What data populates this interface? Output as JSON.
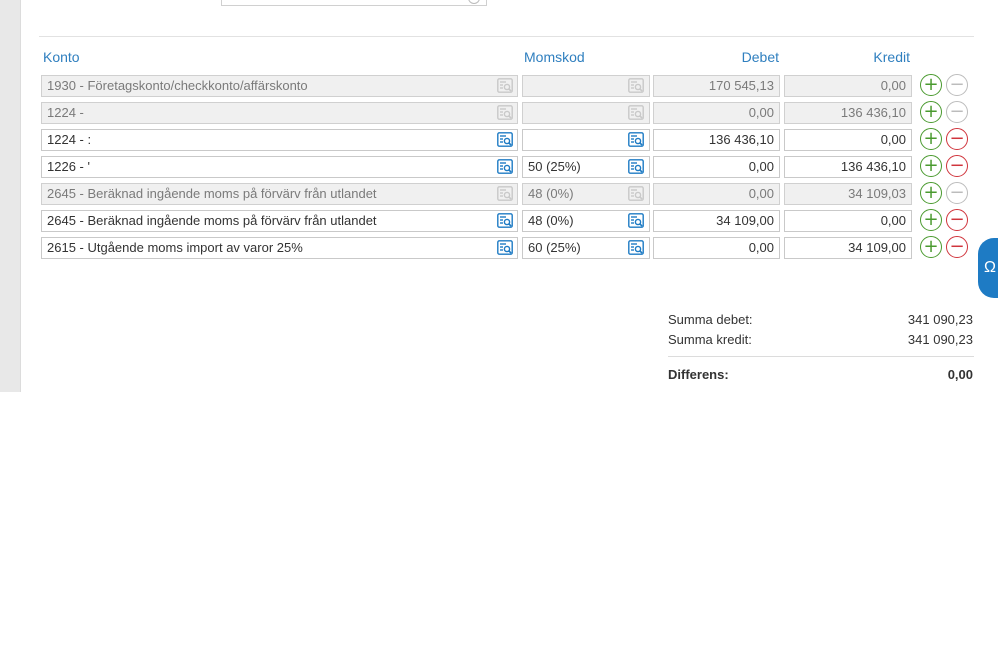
{
  "headers": {
    "konto": "Konto",
    "momskod": "Momskod",
    "debet": "Debet",
    "kredit": "Kredit"
  },
  "rows": [
    {
      "konto": "1930 - Företagskonto/checkkonto/affärskonto",
      "momskod": "",
      "debet": "170 545,13",
      "kredit": "0,00",
      "disabled": true
    },
    {
      "konto": "1224 -",
      "momskod": "",
      "debet": "0,00",
      "kredit": "136 436,10",
      "disabled": true
    },
    {
      "konto": "1224 - :",
      "momskod": "",
      "debet": "136 436,10",
      "kredit": "0,00",
      "disabled": false
    },
    {
      "konto": "1226 - '",
      "momskod": "50 (25%)",
      "debet": "0,00",
      "kredit": "136 436,10",
      "disabled": false
    },
    {
      "konto": "2645 - Beräknad ingående moms på förvärv från utlandet",
      "momskod": "48 (0%)",
      "debet": "0,00",
      "kredit": "34 109,03",
      "disabled": true
    },
    {
      "konto": "2645 - Beräknad ingående moms på förvärv från utlandet",
      "momskod": "48 (0%)",
      "debet": "34 109,00",
      "kredit": "0,00",
      "disabled": false
    },
    {
      "konto": "2615 - Utgående moms import av varor 25%",
      "momskod": "60 (25%)",
      "debet": "0,00",
      "kredit": "34 109,00",
      "disabled": false
    }
  ],
  "summary": {
    "debet_label": "Summa debet:",
    "debet_value": "341 090,23",
    "kredit_label": "Summa kredit:",
    "kredit_value": "341 090,23",
    "diff_label": "Differens:",
    "diff_value": "0,00"
  },
  "icons": {
    "add": "+",
    "remove": "−",
    "side_tab": "Ω"
  },
  "colors": {
    "accent": "#2f7fbf",
    "add": "#4a9a2f",
    "remove": "#d0343c",
    "side_tab": "#1e7bc4"
  }
}
